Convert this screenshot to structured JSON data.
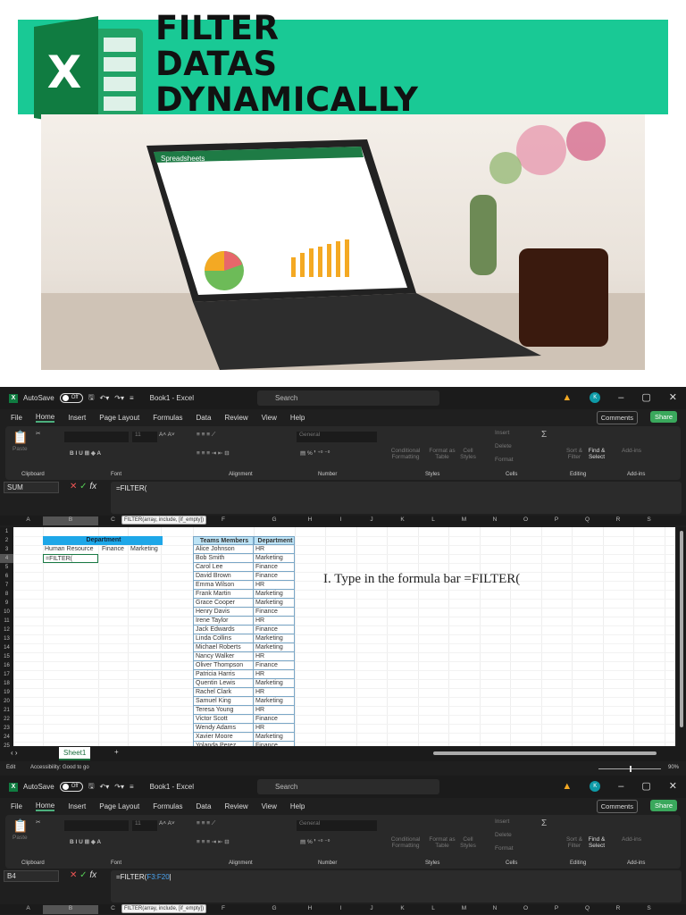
{
  "banner": {
    "title": "FILTER\nDATAS\nDYNAMICALLY",
    "color": "#19c995",
    "logo_letter": "X"
  },
  "photo": {
    "screen_title": "Spreadsheets"
  },
  "excel": {
    "autosave": "AutoSave",
    "toggle": "Off",
    "doc_title": "Book1  -  Excel",
    "search": "Search",
    "avatar": "K",
    "menu": [
      "File",
      "Home",
      "Insert",
      "Page Layout",
      "Formulas",
      "Data",
      "Review",
      "View",
      "Help"
    ],
    "comments": "Comments",
    "share": "Share",
    "groups": [
      "Clipboard",
      "Font",
      "Alignment",
      "Number",
      "Styles",
      "Cells",
      "Editing",
      "Add-ins"
    ],
    "ribbon_labels": {
      "paste": "Paste",
      "font_size": "11",
      "number_format": "General",
      "conditional": "Conditional Formatting",
      "format_as_table": "Format as Table",
      "cell_styles": "Cell Styles",
      "insert": "Insert",
      "delete": "Delete",
      "format": "Format",
      "sort_filter": "Sort & Filter",
      "find_select": "Find & Select",
      "add_ins": "Add-ins"
    },
    "tooltip": "FILTER(array, include, [if_empty])",
    "columns": [
      "A",
      "B",
      "C",
      "D",
      "E",
      "F",
      "G",
      "H",
      "I",
      "J",
      "K",
      "L",
      "M",
      "N",
      "O",
      "P",
      "Q",
      "R",
      "S"
    ],
    "window1": {
      "name_box": "SUM",
      "formula": "=FILTER("
    },
    "window2": {
      "name_box": "B4",
      "formula_prefix": "=FILTER(",
      "formula_ref": "F3:F20"
    },
    "sheet_tab": "Sheet1",
    "status_mode": "Edit",
    "accessibility": "Accessibility: Good to go",
    "zoom": "90%",
    "zoom_fraction": 0.5
  },
  "sheet": {
    "dept_header": "Department",
    "dept_options": [
      "Human Resource",
      "Finance",
      "Marketing"
    ],
    "active_cell": "=FILTER(",
    "table_headers": [
      "Teams Members",
      "Department"
    ],
    "rows": [
      [
        "Alice Johnson",
        "HR"
      ],
      [
        "Bob Smith",
        "Marketing"
      ],
      [
        "Carol Lee",
        "Finance"
      ],
      [
        "David Brown",
        "Finance"
      ],
      [
        "Emma Wilson",
        "HR"
      ],
      [
        "Frank Martin",
        "Marketing"
      ],
      [
        "Grace Cooper",
        "Marketing"
      ],
      [
        "Henry Davis",
        "Finance"
      ],
      [
        "Irene Taylor",
        "HR"
      ],
      [
        "Jack Edwards",
        "Finance"
      ],
      [
        "Linda Collins",
        "Marketing"
      ],
      [
        "Michael Roberts",
        "Marketing"
      ],
      [
        "Nancy Walker",
        "HR"
      ],
      [
        "Oliver Thompson",
        "Finance"
      ],
      [
        "Patricia Harris",
        "HR"
      ],
      [
        "Quentin Lewis",
        "Marketing"
      ],
      [
        "Rachel Clark",
        "HR"
      ],
      [
        "Samuel King",
        "Marketing"
      ],
      [
        "Teresa Young",
        "HR"
      ],
      [
        "Victor Scott",
        "Finance"
      ],
      [
        "Wendy Adams",
        "HR"
      ],
      [
        "Xavier Moore",
        "Marketing"
      ],
      [
        "Yolanda Perez",
        "Finance"
      ]
    ],
    "instruction": "I. Type in the formula bar =FILTER("
  }
}
